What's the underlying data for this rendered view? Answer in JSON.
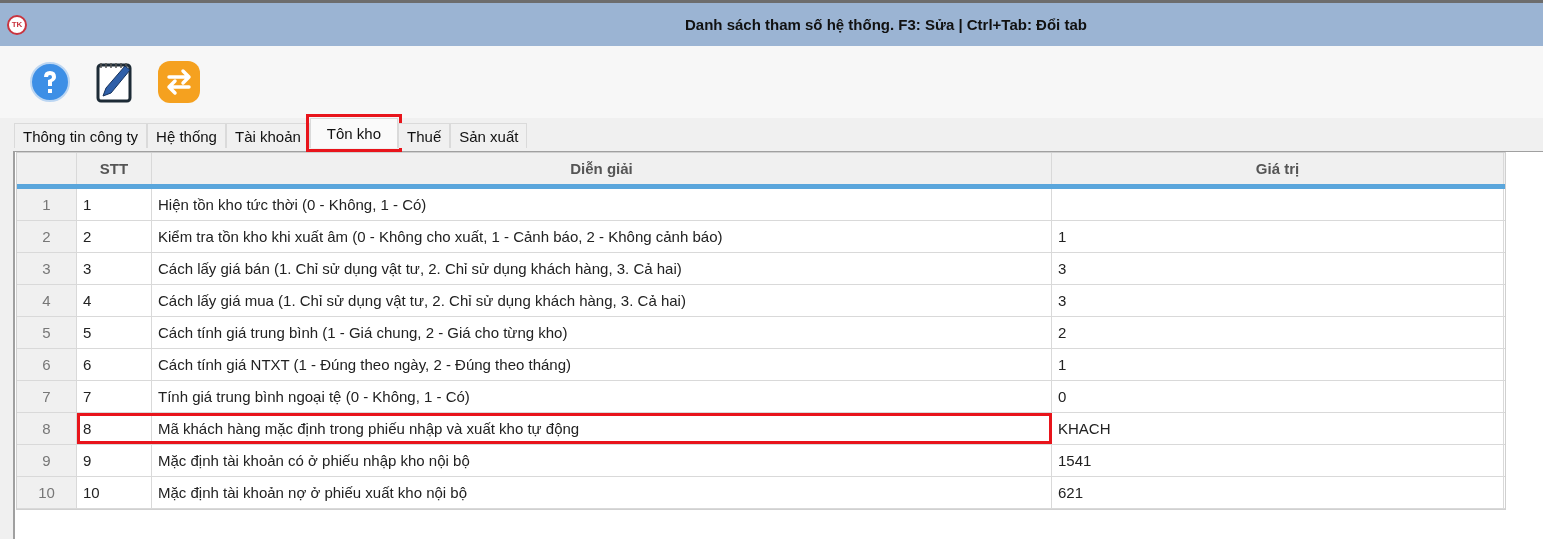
{
  "window": {
    "logo": "TK",
    "title": "Danh sách tham số hệ thống. F3: Sửa | Ctrl+Tab: Đổi tab"
  },
  "toolbar": [
    {
      "kind": "help"
    },
    {
      "kind": "edit"
    },
    {
      "kind": "switch"
    }
  ],
  "tabs": [
    {
      "label": "Thông tin công ty",
      "selected": false,
      "highlighted": false
    },
    {
      "label": "Hệ thống",
      "selected": false,
      "highlighted": false
    },
    {
      "label": "Tài khoản",
      "selected": false,
      "highlighted": false
    },
    {
      "label": "Tôn kho",
      "selected": true,
      "highlighted": true
    },
    {
      "label": "Thuế",
      "selected": false,
      "highlighted": false
    },
    {
      "label": "Sản xuất",
      "selected": false,
      "highlighted": false
    }
  ],
  "table": {
    "columns": [
      "STT",
      "Diễn giải",
      "Giá trị"
    ],
    "rows": [
      {
        "row_number": "1",
        "stt": "1",
        "description": "Hiện tồn kho tức thời (0 - Không, 1 - Có)",
        "value": "",
        "highlighted": false
      },
      {
        "row_number": "2",
        "stt": "2",
        "description": "Kiểm tra tồn kho khi xuất âm (0 - Không cho xuất, 1 - Cảnh báo, 2 - Không cảnh báo)",
        "value": "1",
        "highlighted": false
      },
      {
        "row_number": "3",
        "stt": "3",
        "description": "Cách lấy giá bán (1. Chỉ sử dụng vật tư, 2. Chỉ sử dụng khách hàng, 3. Cả hai)",
        "value": "3",
        "highlighted": false
      },
      {
        "row_number": "4",
        "stt": "4",
        "description": "Cách lấy giá mua (1. Chỉ sử dụng vật tư, 2. Chỉ sử dụng khách hàng, 3. Cả hai)",
        "value": "3",
        "highlighted": false
      },
      {
        "row_number": "5",
        "stt": "5",
        "description": "Cách tính giá trung bình (1 - Giá chung, 2 - Giá cho từng kho)",
        "value": "2",
        "highlighted": false
      },
      {
        "row_number": "6",
        "stt": "6",
        "description": "Cách tính giá NTXT (1 - Đúng theo ngày, 2 - Đúng theo tháng)",
        "value": "1",
        "highlighted": false
      },
      {
        "row_number": "7",
        "stt": "7",
        "description": "Tính giá trung bình ngoại tệ (0 - Không, 1 - Có)",
        "value": "0",
        "highlighted": false
      },
      {
        "row_number": "8",
        "stt": "8",
        "description": "Mã khách hàng mặc định trong phiếu nhập và xuất kho tự động",
        "value": "KHACH",
        "highlighted": true
      },
      {
        "row_number": "9",
        "stt": "9",
        "description": "Mặc định tài khoản có ở phiếu nhập kho nội bộ",
        "value": "1541",
        "highlighted": false
      },
      {
        "row_number": "10",
        "stt": "10",
        "description": "Mặc định tài khoản nợ ở phiếu xuất kho nội bộ",
        "value": "621",
        "highlighted": false
      }
    ]
  }
}
